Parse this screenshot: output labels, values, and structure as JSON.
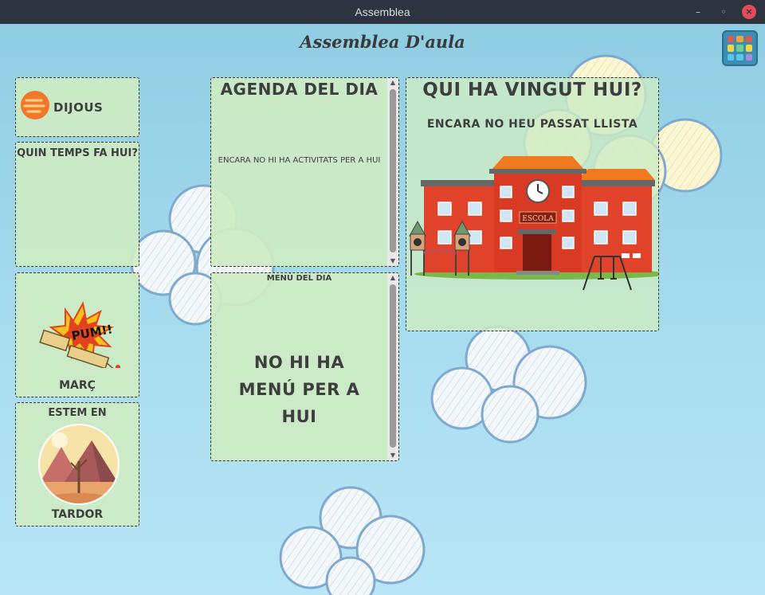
{
  "window": {
    "title": "Assemblea"
  },
  "app": {
    "title": "Assemblea D'aula"
  },
  "day": {
    "label": "DIJOUS"
  },
  "weather": {
    "question": "QUIN TEMPS FA HUI?"
  },
  "month": {
    "label": "MARÇ",
    "badge_text": "PUM!!"
  },
  "season": {
    "prefix": "ESTEM EN",
    "label": "TARDOR"
  },
  "agenda": {
    "title": "AGENDA DEL DIA",
    "empty_text": "ENCARA NO HI HA ACTIVITATS PER A HUI"
  },
  "menu": {
    "title": "MENÚ DEL DIA",
    "empty_text": "NO HI HA MENÚ PER A HUI"
  },
  "attendance": {
    "title": "QUI HA VINGUT HUI?",
    "subtitle": "ENCARA NO HEU PASSAT LLISTA",
    "school_sign": "ESCOLA"
  },
  "colors": {
    "titlebar": "#2e3340",
    "panel": "#cdecc4",
    "sky": "#a7dcef",
    "school_wall": "#e0422a",
    "school_roof": "#f07a1e",
    "apps_grid": [
      "#e05a4e",
      "#f2a23a",
      "#e05a4e",
      "#f5d547",
      "#6fd08c",
      "#f5d547",
      "#5cc6e8",
      "#5cc6e8",
      "#a88be0"
    ]
  },
  "icons": {
    "sun": "sun-icon",
    "firecracker": "firecracker-icon",
    "season": "autumn-landscape-icon",
    "school": "school-illustration",
    "apps": "apps-grid-icon"
  }
}
